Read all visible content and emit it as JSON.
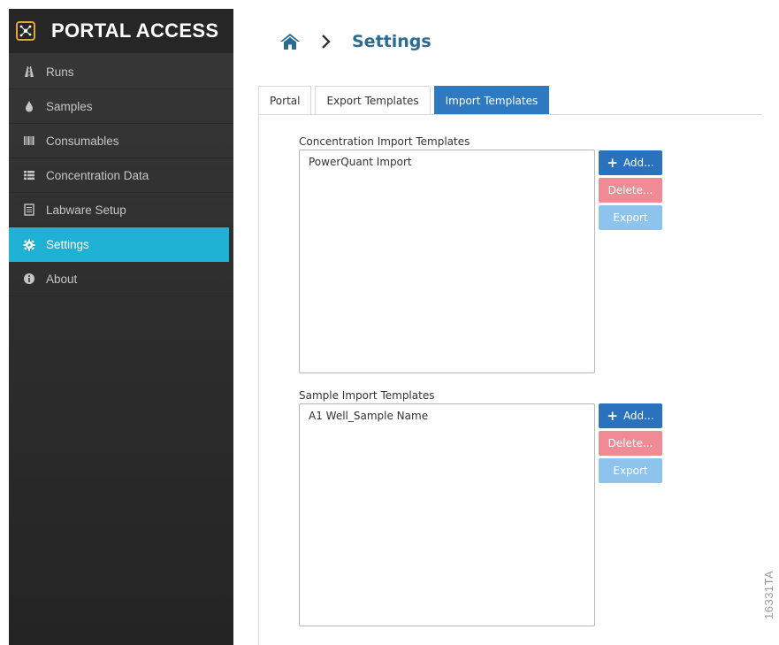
{
  "brand": {
    "title": "PORTAL ACCESS"
  },
  "sidebar": {
    "items": [
      {
        "label": "Runs",
        "icon": "road-icon"
      },
      {
        "label": "Samples",
        "icon": "droplet-icon"
      },
      {
        "label": "Consumables",
        "icon": "barcode-icon"
      },
      {
        "label": "Concentration Data",
        "icon": "list-icon"
      },
      {
        "label": "Labware Setup",
        "icon": "document-icon"
      },
      {
        "label": "Settings",
        "icon": "gear-icon",
        "active": true
      },
      {
        "label": "About",
        "icon": "info-icon"
      }
    ]
  },
  "header": {
    "title": "Settings"
  },
  "tabs": [
    {
      "label": "Portal"
    },
    {
      "label": "Export Templates"
    },
    {
      "label": "Import Templates",
      "active": true
    }
  ],
  "concentration": {
    "label": "Concentration Import Templates",
    "items": [
      "PowerQuant Import"
    ],
    "add_label": "Add...",
    "delete_label": "Delete...",
    "export_label": "Export"
  },
  "sample": {
    "label": "Sample Import Templates",
    "items": [
      "A1 Well_Sample Name"
    ],
    "add_label": "Add...",
    "delete_label": "Delete...",
    "export_label": "Export"
  },
  "watermark": "16331TA",
  "colors": {
    "accent": "#1fb1d4",
    "primary": "#2a72be",
    "danger": "#f08b95",
    "info": "#8ec4ec",
    "title": "#2b6c92"
  }
}
